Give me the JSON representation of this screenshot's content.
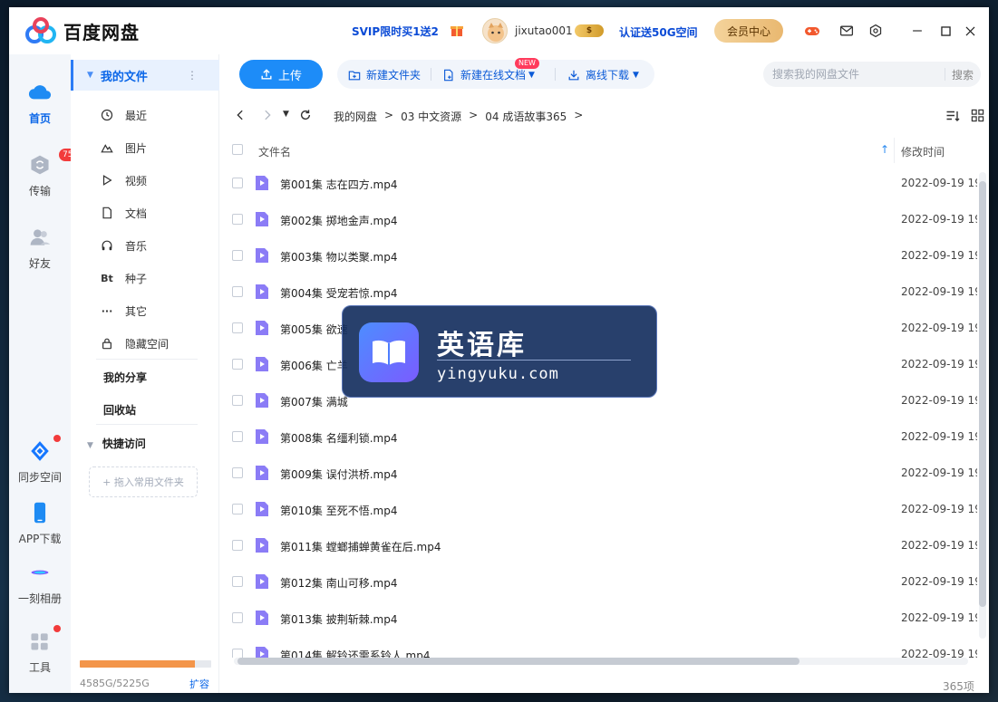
{
  "app": {
    "name": "百度网盘"
  },
  "header": {
    "svip_promo": "SVIP限时买1送2",
    "username": "jixutao001",
    "cert_promo": "认证送50G空间",
    "member_center": "会员中心"
  },
  "leftnav": {
    "home": "首页",
    "transfer": "传输",
    "transfer_badge": "75",
    "friends": "好友",
    "sync": "同步空间",
    "app_download": "APP下载",
    "album": "一刻相册",
    "tools": "工具"
  },
  "sidebar": {
    "my_files": "我的文件",
    "items": [
      {
        "label": "最近",
        "icon": "clock-icon"
      },
      {
        "label": "图片",
        "icon": "image-icon"
      },
      {
        "label": "视频",
        "icon": "play-icon"
      },
      {
        "label": "文档",
        "icon": "document-icon"
      },
      {
        "label": "音乐",
        "icon": "headphones-icon"
      },
      {
        "label": "种子",
        "icon": "torrent-icon",
        "glyph": "Bt"
      },
      {
        "label": "其它",
        "icon": "more-icon"
      },
      {
        "label": "隐藏空间",
        "icon": "lock-icon"
      }
    ],
    "my_share": "我的分享",
    "recycle": "回收站",
    "quick_access": "快捷访问",
    "add_common_folder": "+ 拖入常用文件夹",
    "quota": {
      "text": "4585G/5225G",
      "used": 4585,
      "total": 5225
    },
    "expand": "扩容"
  },
  "toolbar": {
    "upload": "上传",
    "new_folder": "新建文件夹",
    "new_online_doc": "新建在线文档",
    "new_badge": "NEW",
    "offline_download": "离线下载",
    "search_placeholder": "搜索我的网盘文件",
    "search_button": "搜索"
  },
  "breadcrumb": [
    "我的网盘",
    "03 中文资源",
    "04 成语故事365"
  ],
  "table": {
    "col_name": "文件名",
    "col_time": "修改时间",
    "rows": [
      {
        "name": "第001集 志在四方.mp4",
        "time": "2022-09-19 19:"
      },
      {
        "name": "第002集 掷地金声.mp4",
        "time": "2022-09-19 19:"
      },
      {
        "name": "第003集 物以类聚.mp4",
        "time": "2022-09-19 19:"
      },
      {
        "name": "第004集 受宠若惊.mp4",
        "time": "2022-09-19 19:"
      },
      {
        "name": "第005集 欲速",
        "time": "2022-09-19 19:"
      },
      {
        "name": "第006集 亡羊",
        "time": "2022-09-19 19:"
      },
      {
        "name": "第007集 满城",
        "time": "2022-09-19 19:"
      },
      {
        "name": "第008集 名缰利锁.mp4",
        "time": "2022-09-19 19:"
      },
      {
        "name": "第009集 误付洪桥.mp4",
        "time": "2022-09-19 19:"
      },
      {
        "name": "第010集 至死不悟.mp4",
        "time": "2022-09-19 19:"
      },
      {
        "name": "第011集 螳螂捕蝉黄雀在后.mp4",
        "time": "2022-09-19 19:"
      },
      {
        "name": "第012集 南山可移.mp4",
        "time": "2022-09-19 19:"
      },
      {
        "name": "第013集 披荆斩棘.mp4",
        "time": "2022-09-19 19:"
      },
      {
        "name": "第014集 解铃还需系铃人.mp4",
        "time": "2022-09-19 19:"
      }
    ]
  },
  "footer": {
    "count": "365项"
  },
  "watermark": {
    "title": "英语库",
    "url": "yingyuku.com"
  }
}
